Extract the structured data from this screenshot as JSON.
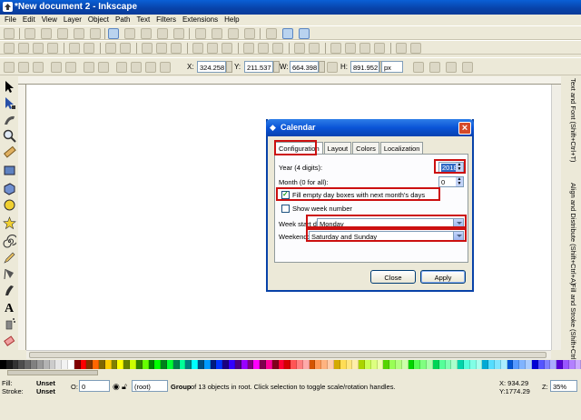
{
  "window": {
    "title": "*New document 2 - Inkscape"
  },
  "menubar": [
    "File",
    "Edit",
    "View",
    "Layer",
    "Object",
    "Path",
    "Text",
    "Filters",
    "Extensions",
    "Help"
  ],
  "toolcontrols": {
    "x_label": "X:",
    "x_value": "324.258",
    "y_label": "Y:",
    "y_value": "211.537",
    "w_label": "W:",
    "w_value": "664.398",
    "h_label": "H:",
    "h_value": "891.952",
    "unit": "px"
  },
  "docks": [
    "Text and Font (Shift+Ctrl+T)",
    "Align and Distribute (Shift+Ctrl+A)",
    "Fill and Stroke (Shift+Ctrl+F)"
  ],
  "dialog": {
    "title": "Calendar",
    "tabs": [
      "Configuration",
      "Layout",
      "Colors",
      "Localization"
    ],
    "year_label": "Year (4 digits):",
    "year_value": "2018",
    "month_label": "Month (0 for all):",
    "month_value": "0",
    "fill_empty_label": "Fill empty day boxes with next month's days",
    "fill_empty_checked": true,
    "week_number_label": "Show week number",
    "week_number_checked": false,
    "week_start_label": "Week start day:",
    "week_start_value": "Monday",
    "weekend_label": "Weekend:",
    "weekend_value": "Saturday and Sunday",
    "close_label": "Close",
    "apply_label": "Apply"
  },
  "palette_colors": [
    "#000000",
    "#1a1a1a",
    "#333333",
    "#4d4d4d",
    "#666666",
    "#808080",
    "#999999",
    "#b3b3b3",
    "#cccccc",
    "#e6e6e6",
    "#f2f2f2",
    "#ffffff",
    "#800000",
    "#ff0000",
    "#803300",
    "#ff6600",
    "#806600",
    "#ffcc00",
    "#808000",
    "#ffff00",
    "#668000",
    "#ccff00",
    "#338000",
    "#66ff00",
    "#008000",
    "#00ff00",
    "#00801a",
    "#00ff33",
    "#00804d",
    "#00ff99",
    "#008080",
    "#00ffff",
    "#004d80",
    "#0099ff",
    "#001a80",
    "#0033ff",
    "#1a0080",
    "#3300ff",
    "#4d0080",
    "#9900ff",
    "#800080",
    "#ff00ff",
    "#80004d",
    "#ff0099",
    "#80001a",
    "#ff0033",
    "#d40000",
    "#ff5555",
    "#ff8080",
    "#ffaaaa",
    "#d45500",
    "#ff9955",
    "#ffb380",
    "#ffccaa",
    "#d4aa00",
    "#ffdd55",
    "#ffe680",
    "#ffeeaa",
    "#aad400",
    "#ccff55",
    "#ddff80",
    "#eeffaa",
    "#55d400",
    "#99ff55",
    "#b3ff80",
    "#ccffaa",
    "#00d400",
    "#55ff55",
    "#80ff80",
    "#aaffaa",
    "#00d455",
    "#55ff99",
    "#80ffb3",
    "#aaffcc",
    "#00d4aa",
    "#55ffdd",
    "#80ffe6",
    "#aaffee",
    "#00aad4",
    "#55ddff",
    "#80e5ff",
    "#aaeeff",
    "#0055d4",
    "#5599ff",
    "#80b3ff",
    "#aaccff",
    "#0000d4",
    "#5555ff",
    "#8080ff",
    "#aaaaff",
    "#5500d4",
    "#9955ff",
    "#b380ff",
    "#ccaaff"
  ],
  "status": {
    "fill_label": "Fill:",
    "fill_value": "Unset",
    "stroke_label": "Stroke:",
    "stroke_value": "Unset",
    "opacity_label": "O:",
    "opacity_value": "0",
    "layer_value": "(root)",
    "message_bold": "Group",
    "message_rest": " of 13 objects in root. Click selection to toggle scale/rotation handles.",
    "x_coord": "X:  934.29",
    "y_coord": "Y:1774.29",
    "zoom_label": "Z:",
    "zoom_value": "35%"
  },
  "highlight_color": "#cc1010"
}
